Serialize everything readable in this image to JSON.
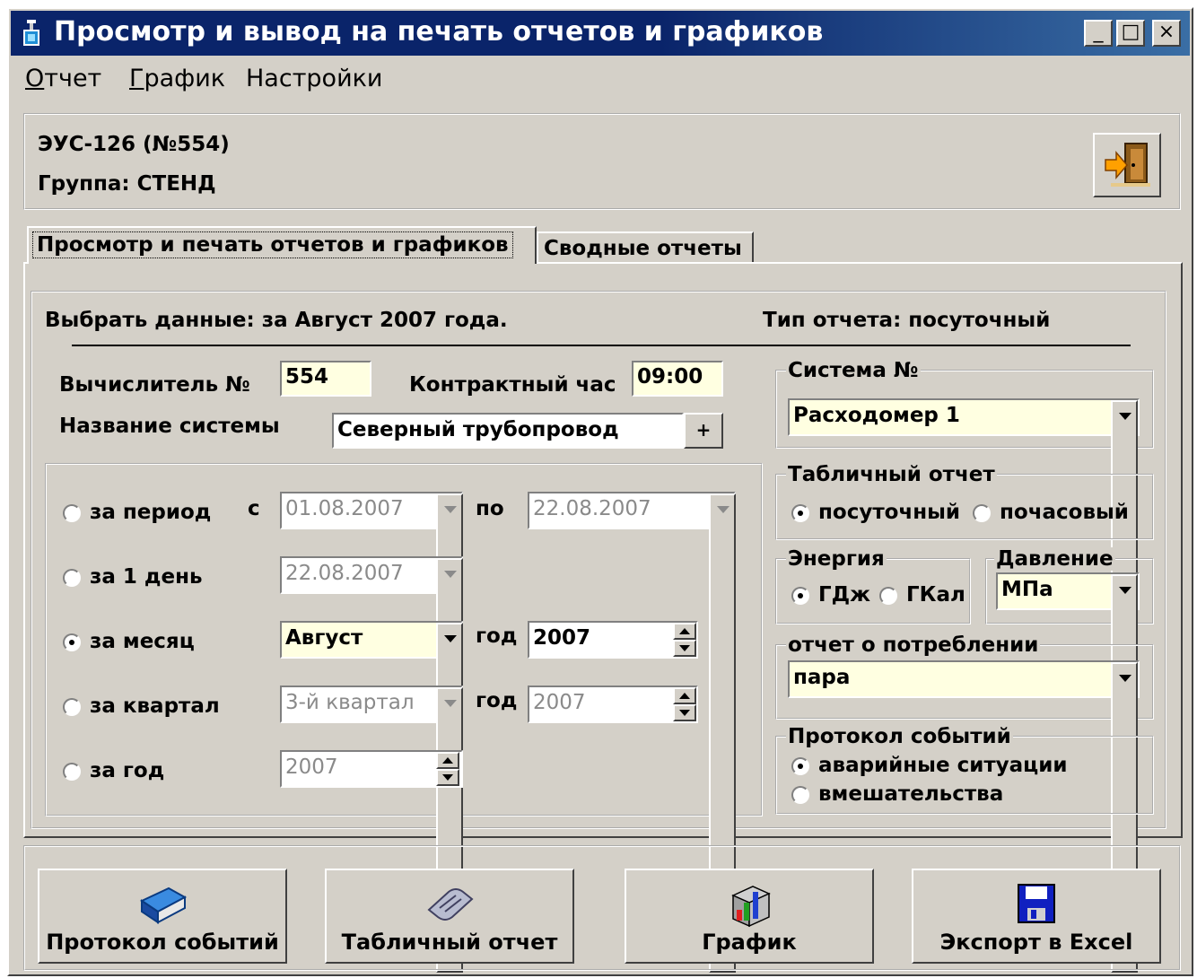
{
  "window": {
    "title": "Просмотр и вывод на печать отчетов и графиков",
    "controls": {
      "minimize": "_",
      "maximize": "□",
      "close": "×"
    }
  },
  "menu": [
    "Отчет",
    "График",
    "Настройки"
  ],
  "header": {
    "device": "ЭУС-126 (№554)",
    "group": "Группа: СТЕНД"
  },
  "tabs": [
    "Просмотр и печать отчетов и графиков",
    "Сводные отчеты"
  ],
  "summary": {
    "select_data": "Выбрать данные: за Август 2007 года.",
    "report_type": "Тип отчета:  посуточный"
  },
  "calc": {
    "calc_label": "Вычислитель №",
    "calc_value": "554",
    "contract_label": "Контрактный час",
    "contract_value": "09:00",
    "system_name_label": "Название системы",
    "system_name_value": "Северный трубопровод",
    "system_name_btn": "+"
  },
  "period": {
    "range": {
      "label": "за период",
      "from_label": "с",
      "from": "01.08.2007",
      "to_label": "по",
      "to": "22.08.2007",
      "selected": false
    },
    "day": {
      "label": "за 1 день",
      "value": "22.08.2007",
      "selected": false
    },
    "month": {
      "label": "за месяц",
      "value": "Август",
      "year_label": "год",
      "year": "2007",
      "selected": true
    },
    "quarter": {
      "label": "за квартал",
      "value": "3-й квартал",
      "year_label": "год",
      "year": "2007",
      "selected": false
    },
    "year": {
      "label": "за год",
      "value": "2007",
      "selected": false
    }
  },
  "right": {
    "system_title": "Система №",
    "system_value": "Расходомер 1",
    "table_title": "Табличный отчет",
    "table_opt1": "посуточный",
    "table_opt2": "почасовый",
    "energy_title": "Энергия",
    "energy_opt1": "ГДж",
    "energy_opt2": "ГКал",
    "pressure_title": "Давление",
    "pressure_value": "МПа",
    "consumption_title": "отчет о потреблении",
    "consumption_value": "пара",
    "events_title": "Протокол событий",
    "events_opt1": "аварийные ситуации",
    "events_opt2": "вмешательства"
  },
  "buttons": [
    "Протокол событий",
    "Табличный отчет",
    "График",
    "Экспорт в Excel"
  ],
  "colors": {
    "face": "#d4d0c8",
    "titlebar": "#0a246a",
    "field": "#ffffe1"
  }
}
